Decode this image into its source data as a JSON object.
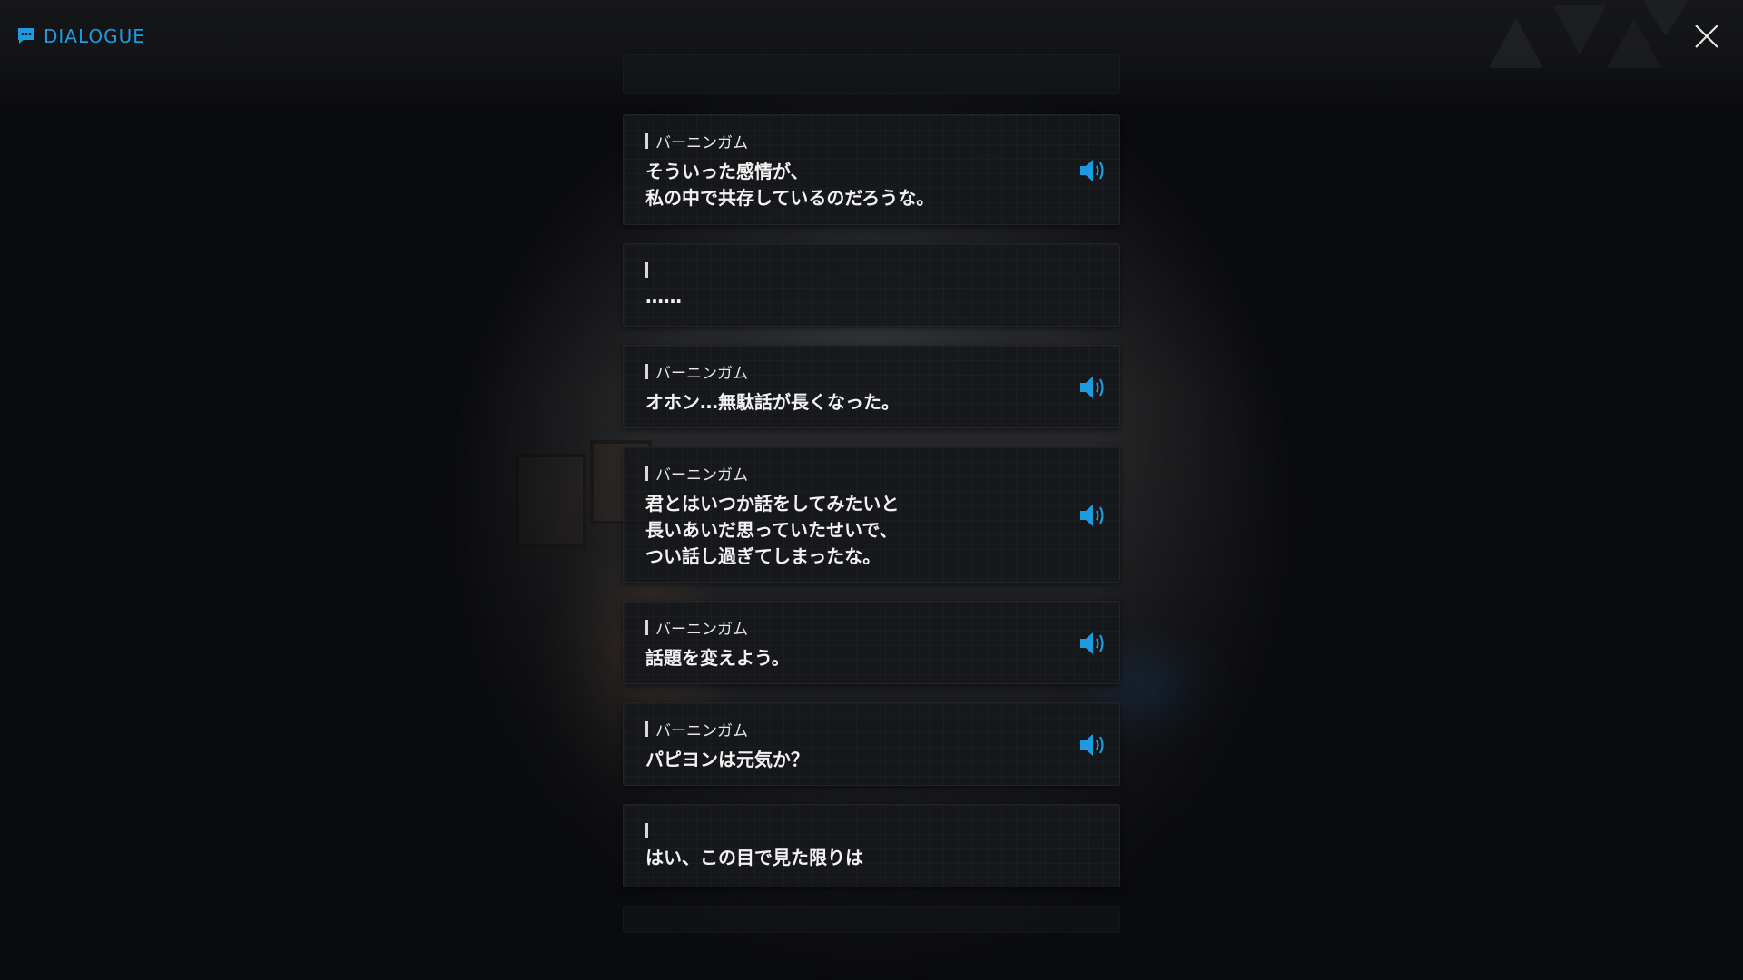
{
  "header": {
    "title": "DIALOGUE",
    "icon": "chat-bubble-icon",
    "accent_color": "#1e9bdf"
  },
  "close": {
    "icon": "close-icon"
  },
  "dialogue": [
    {
      "speaker": "バーニンガム",
      "text": "そういった感情が、\n私の中で共存しているのだろうな。",
      "has_voice": true
    },
    {
      "speaker": "",
      "text": "……",
      "has_voice": false
    },
    {
      "speaker": "バーニンガム",
      "text": "オホン…無駄話が長くなった。",
      "has_voice": true
    },
    {
      "speaker": "バーニンガム",
      "text": "君とはいつか話をしてみたいと\n長いあいだ思っていたせいで、\nつい話し過ぎてしまったな。",
      "has_voice": true
    },
    {
      "speaker": "バーニンガム",
      "text": "話題を変えよう。",
      "has_voice": true
    },
    {
      "speaker": "バーニンガム",
      "text": "パピヨンは元気か？",
      "has_voice": true
    },
    {
      "speaker": "",
      "text": "はい、この目で見た限りは",
      "has_voice": false
    }
  ]
}
